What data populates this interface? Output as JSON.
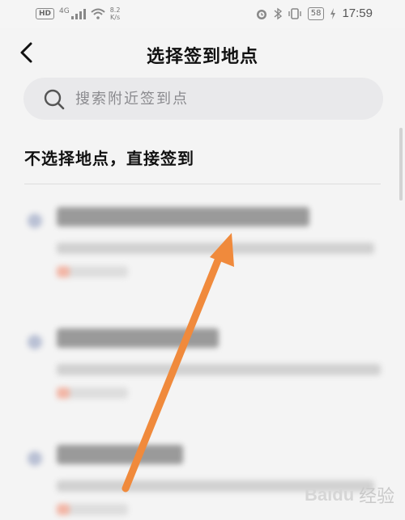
{
  "status_bar": {
    "hd": "HD",
    "network": "4G",
    "speed_value": "8.2",
    "speed_unit": "K/s",
    "battery": "58",
    "time": "17:59"
  },
  "header": {
    "title": "选择签到地点"
  },
  "search": {
    "placeholder": "搜索附近签到点"
  },
  "no_location_option": "不选择地点，直接签到",
  "watermark": {
    "logo": "Bai",
    "logo_suffix": "du",
    "text": "经验"
  },
  "colors": {
    "arrow": "#f08a3c",
    "background": "#f4f4f4",
    "search_bg": "#e9e9eb"
  }
}
